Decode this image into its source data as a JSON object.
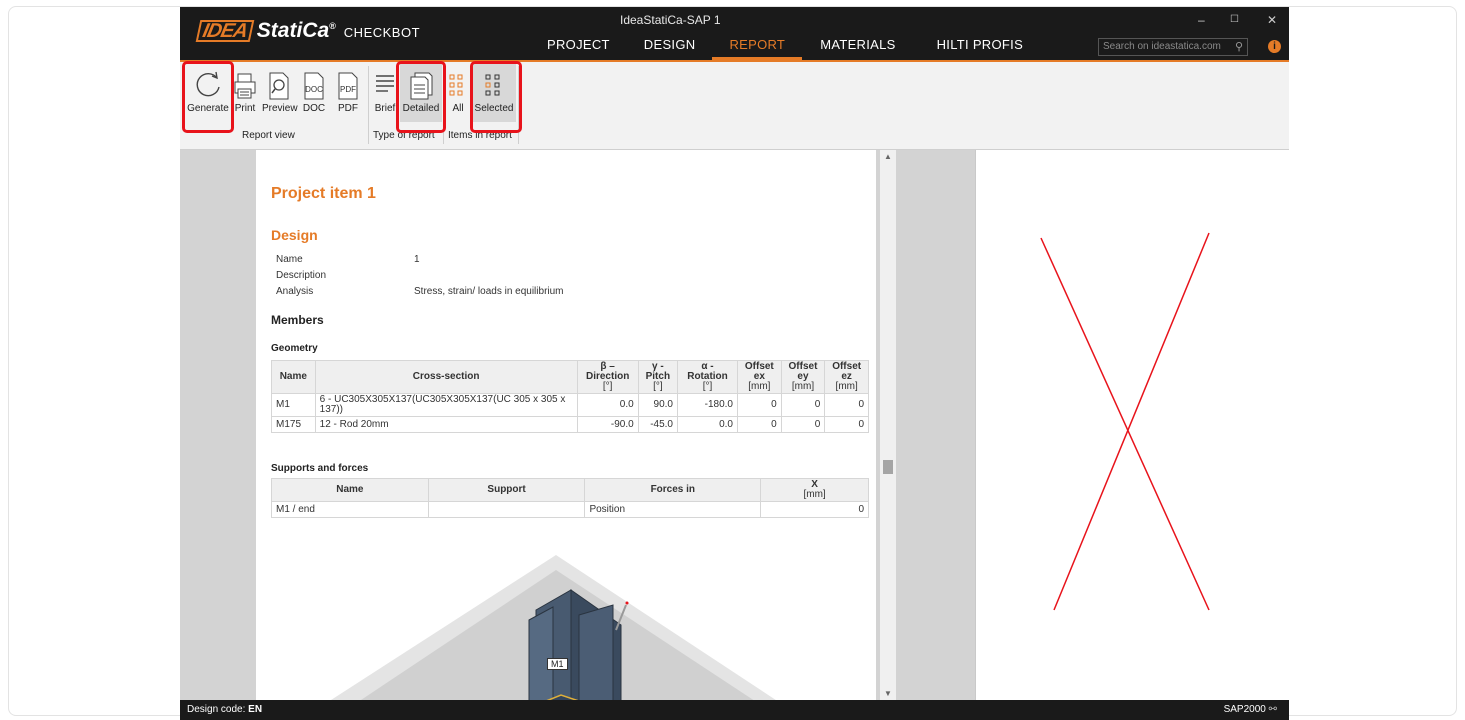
{
  "window": {
    "title": "IdeaStatiCa-SAP 1",
    "brand_logo": "IDEA",
    "brand_name": "StatiCa",
    "brand_registered": "®",
    "brand_product": "CHECKBOT",
    "controls": {
      "minimize": "–",
      "maximize": "☐",
      "close": "✕"
    }
  },
  "nav": {
    "tabs": [
      "PROJECT",
      "DESIGN",
      "REPORT",
      "MATERIALS",
      "HILTI PROFIS"
    ],
    "active": "REPORT"
  },
  "search": {
    "placeholder": "Search on ideastatica.com"
  },
  "info_badge": "i",
  "ribbon": {
    "report_view": {
      "label": "Report view",
      "generate": "Generate",
      "print": "Print",
      "preview": "Preview",
      "doc": "DOC",
      "pdf": "PDF"
    },
    "type_of_report": {
      "label": "Type of report",
      "brief": "Brief",
      "detailed": "Detailed"
    },
    "items_in_report": {
      "label": "Items in report",
      "all": "All",
      "selected": "Selected"
    }
  },
  "report": {
    "title": "Project item 1",
    "design_heading": "Design",
    "design": {
      "name_label": "Name",
      "name_value": "1",
      "description_label": "Description",
      "description_value": "",
      "analysis_label": "Analysis",
      "analysis_value": "Stress, strain/ loads in equilibrium"
    },
    "members_heading": "Members",
    "geometry_heading": "Geometry",
    "geometry_table": {
      "headers": [
        [
          "Name"
        ],
        [
          "Cross-section"
        ],
        [
          "β –",
          "Direction",
          "[°]"
        ],
        [
          "γ -",
          "Pitch",
          "[°]"
        ],
        [
          "α -",
          "Rotation",
          "[°]"
        ],
        [
          "Offset",
          "ex",
          "[mm]"
        ],
        [
          "Offset",
          "ey",
          "[mm]"
        ],
        [
          "Offset",
          "ez",
          "[mm]"
        ]
      ],
      "rows": [
        [
          "M1",
          "6 - UC305X305X137(UC305X305X137(UC 305 x 305 x 137))",
          "0.0",
          "90.0",
          "-180.0",
          "0",
          "0",
          "0"
        ],
        [
          "M175",
          "12 - Rod 20mm",
          "-90.0",
          "-45.0",
          "0.0",
          "0",
          "0",
          "0"
        ]
      ]
    },
    "supports_heading": "Supports and forces",
    "supports_table": {
      "headers": [
        [
          "Name"
        ],
        [
          "Support"
        ],
        [
          "Forces in"
        ],
        [
          "X",
          "[mm]"
        ]
      ],
      "rows": [
        [
          "M1 / end",
          "",
          "Position",
          "0"
        ]
      ]
    },
    "model_label": "M1"
  },
  "status": {
    "design_code_label": "Design code:",
    "design_code": "EN",
    "app": "SAP2000"
  },
  "colors": {
    "accent": "#e57b27",
    "highlight": "#e8131b",
    "titlebar": "#1a1a1a"
  }
}
